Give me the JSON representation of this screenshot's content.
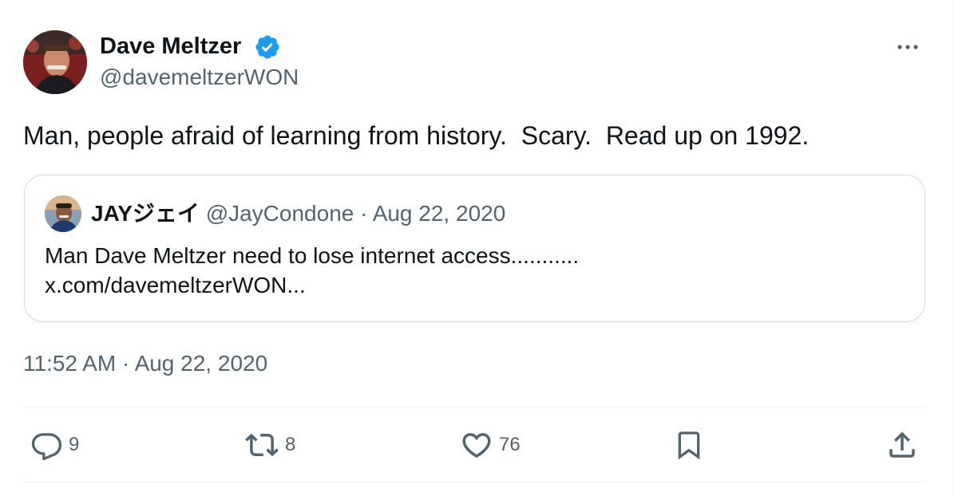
{
  "tweet": {
    "author": {
      "name": "Dave Meltzer",
      "handle": "@davemeltzerWON",
      "verified": true
    },
    "text": "Man, people afraid of learning from history.  Scary.  Read up on 1992.",
    "quoted": {
      "name": "JAYジェイ",
      "handle": "@JayCondone",
      "separator": "·",
      "date": "Aug 22, 2020",
      "text_line1": "Man Dave Meltzer need to lose internet access...........",
      "text_line2": "x.com/davemeltzerWON..."
    },
    "timestamp": "11:52 AM · Aug 22, 2020",
    "actions": {
      "replies": "9",
      "reposts": "8",
      "likes": "76"
    }
  },
  "icons": {
    "more": "more-horizontal-icon",
    "verified": "verified-badge-icon",
    "reply": "reply-icon",
    "repost": "repost-icon",
    "like": "heart-icon",
    "bookmark": "bookmark-icon",
    "share": "share-icon"
  },
  "colors": {
    "verified": "#1d9bf0",
    "text": "#0f1419",
    "secondary": "#536471",
    "border": "#cfd9de"
  }
}
